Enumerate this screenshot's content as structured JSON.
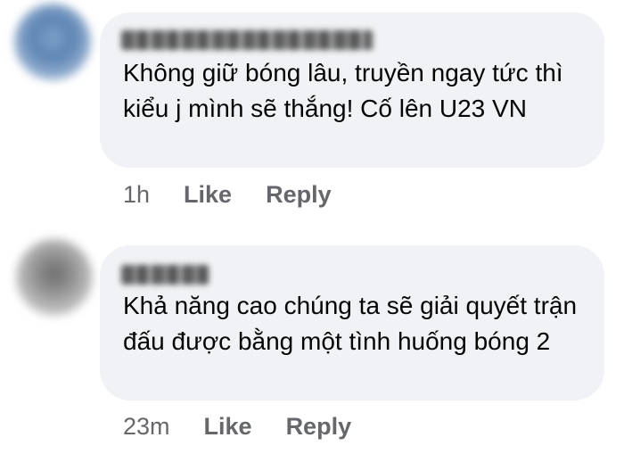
{
  "comments": [
    {
      "text": "Không giữ bóng lâu, truyền ngay tức thì kiểu j mình sẽ thắng! Cố lên U23 VN",
      "time": "1h",
      "like_label": "Like",
      "reply_label": "Reply"
    },
    {
      "text": "Khả năng cao chúng ta sẽ giải quyết trận đấu được bằng một tình huống bóng 2",
      "time": "23m",
      "like_label": "Like",
      "reply_label": "Reply"
    }
  ]
}
